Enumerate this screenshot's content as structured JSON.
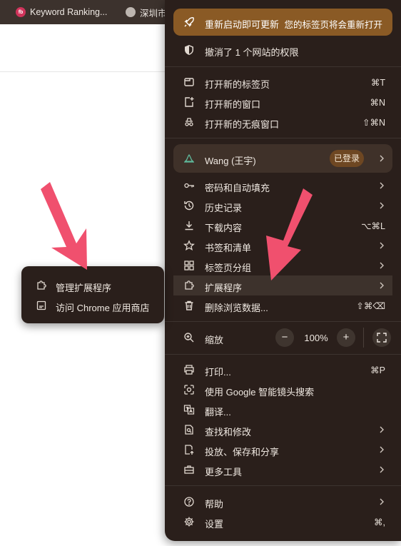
{
  "bookmarks": [
    {
      "label": "Keyword Ranking...",
      "icon": "bookmark-favicon-icon",
      "badge": "fb"
    },
    {
      "label": "深圳市",
      "icon": "globe-icon"
    }
  ],
  "menu": {
    "update": {
      "label": "重新启动即可更新",
      "note": "您的标签页将会重新打开"
    },
    "permissions": {
      "label": "撤消了 1 个网站的权限"
    },
    "new_tab": {
      "label": "打开新的标签页",
      "shortcut": "⌘T"
    },
    "new_window": {
      "label": "打开新的窗口",
      "shortcut": "⌘N"
    },
    "incognito": {
      "label": "打开新的无痕窗口",
      "shortcut": "⇧⌘N"
    },
    "profile": {
      "name": "Wang (王宇)",
      "badge": "已登录"
    },
    "passwords": {
      "label": "密码和自动填充"
    },
    "history": {
      "label": "历史记录"
    },
    "downloads": {
      "label": "下载内容",
      "shortcut": "⌥⌘L"
    },
    "bookmarks_lists": {
      "label": "书签和清单"
    },
    "tab_groups": {
      "label": "标签页分组"
    },
    "extensions": {
      "label": "扩展程序"
    },
    "clear_data": {
      "label": "删除浏览数据...",
      "shortcut": "⇧⌘⌫"
    },
    "zoom": {
      "label": "缩放",
      "value": "100%",
      "minus": "−",
      "plus": "+"
    },
    "print": {
      "label": "打印...",
      "shortcut": "⌘P"
    },
    "lens": {
      "label": "使用 Google 智能镜头搜索"
    },
    "translate": {
      "label": "翻译..."
    },
    "find": {
      "label": "查找和修改"
    },
    "cast": {
      "label": "投放、保存和分享"
    },
    "more_tools": {
      "label": "更多工具"
    },
    "help": {
      "label": "帮助"
    },
    "settings": {
      "label": "设置",
      "shortcut": "⌘,"
    }
  },
  "submenu": {
    "manage": {
      "label": "管理扩展程序"
    },
    "store": {
      "label": "访问 Chrome 应用商店"
    }
  },
  "colors": {
    "menu_bg": "#2a1f1b",
    "update_bg": "#8a5a25",
    "profile_bg": "#3f3129",
    "highlight_bg": "#3d322c",
    "arrow": "#f0506e"
  }
}
